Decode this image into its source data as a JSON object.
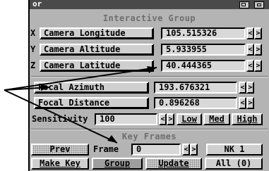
{
  "window": {
    "title_fragment": "or"
  },
  "interactive_group": {
    "title": "Interactive Group",
    "rows": [
      {
        "axis": "X",
        "label": "Camera Longitude",
        "value": "105.515326"
      },
      {
        "axis": "Y",
        "label": "Camera Altitude",
        "value": "5.933955"
      },
      {
        "axis": "Z",
        "label": "Camera Latitude",
        "value": "40.444365"
      }
    ],
    "focal": [
      {
        "label": "Focal Azimuth",
        "value": "193.676321"
      },
      {
        "label": "Focal Distance",
        "value": "0.896268"
      }
    ],
    "arrow_left": "<",
    "arrow_right": ">"
  },
  "sensitivity": {
    "label": "Sensitivity",
    "value": "100",
    "low": "Low",
    "med": "Med",
    "high": "High"
  },
  "key_frames": {
    "title": "Key Frames",
    "prev": "Prev",
    "frame_label": "Frame",
    "frame_value": "0",
    "nk": "NK 1"
  },
  "bottom": {
    "make_key": "Make Key",
    "group": "Group",
    "update": "Update",
    "all": "All (0)"
  }
}
